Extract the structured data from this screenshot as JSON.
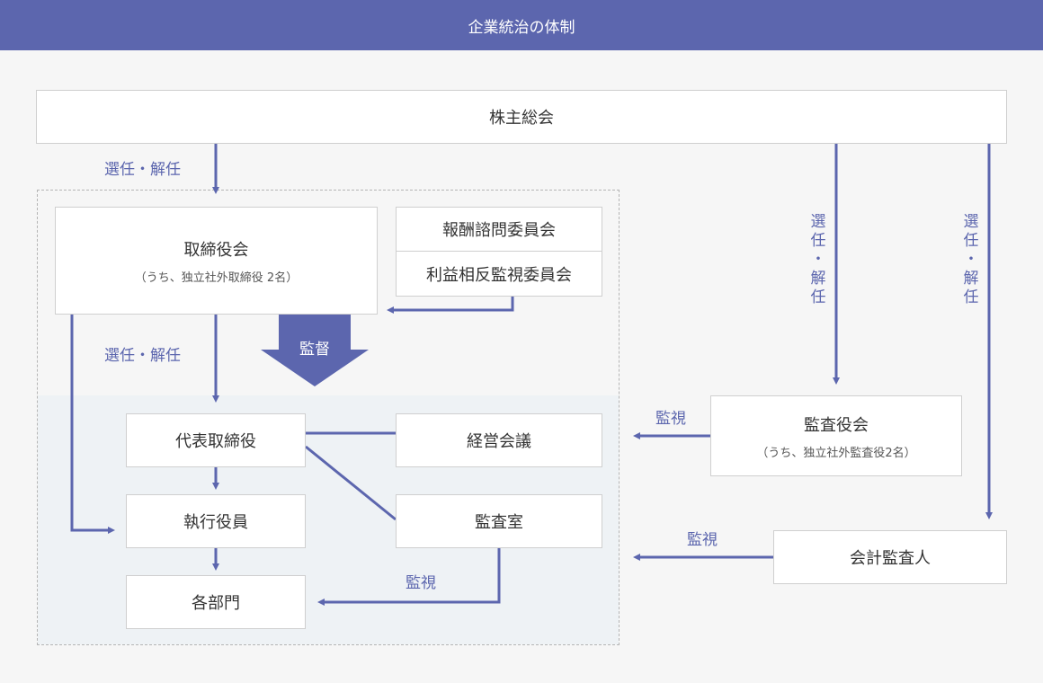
{
  "title": "企業統治の体制",
  "nodes": {
    "shareholders": "株主総会",
    "board": "取締役会",
    "board_note": "（うち、独立社外取締役 2名）",
    "compensation_committee": "報酬諮問委員会",
    "conflict_committee": "利益相反監視委員会",
    "representative_director": "代表取締役",
    "management_meeting": "経営会議",
    "executive_officers": "執行役員",
    "audit_office": "監査室",
    "departments": "各部門",
    "audit_board": "監査役会",
    "audit_board_note": "（うち、独立社外監査役2名）",
    "accounting_auditor": "会計監査人"
  },
  "labels": {
    "elect_dismiss": "選任・解任",
    "supervision": "監督",
    "monitoring": "監視",
    "elect_vertical": [
      "選",
      "任",
      "・",
      "解",
      "任"
    ]
  },
  "colors": {
    "accent": "#5c66ae",
    "shaded_area": "#eef2f5",
    "background": "#f6f6f6"
  }
}
